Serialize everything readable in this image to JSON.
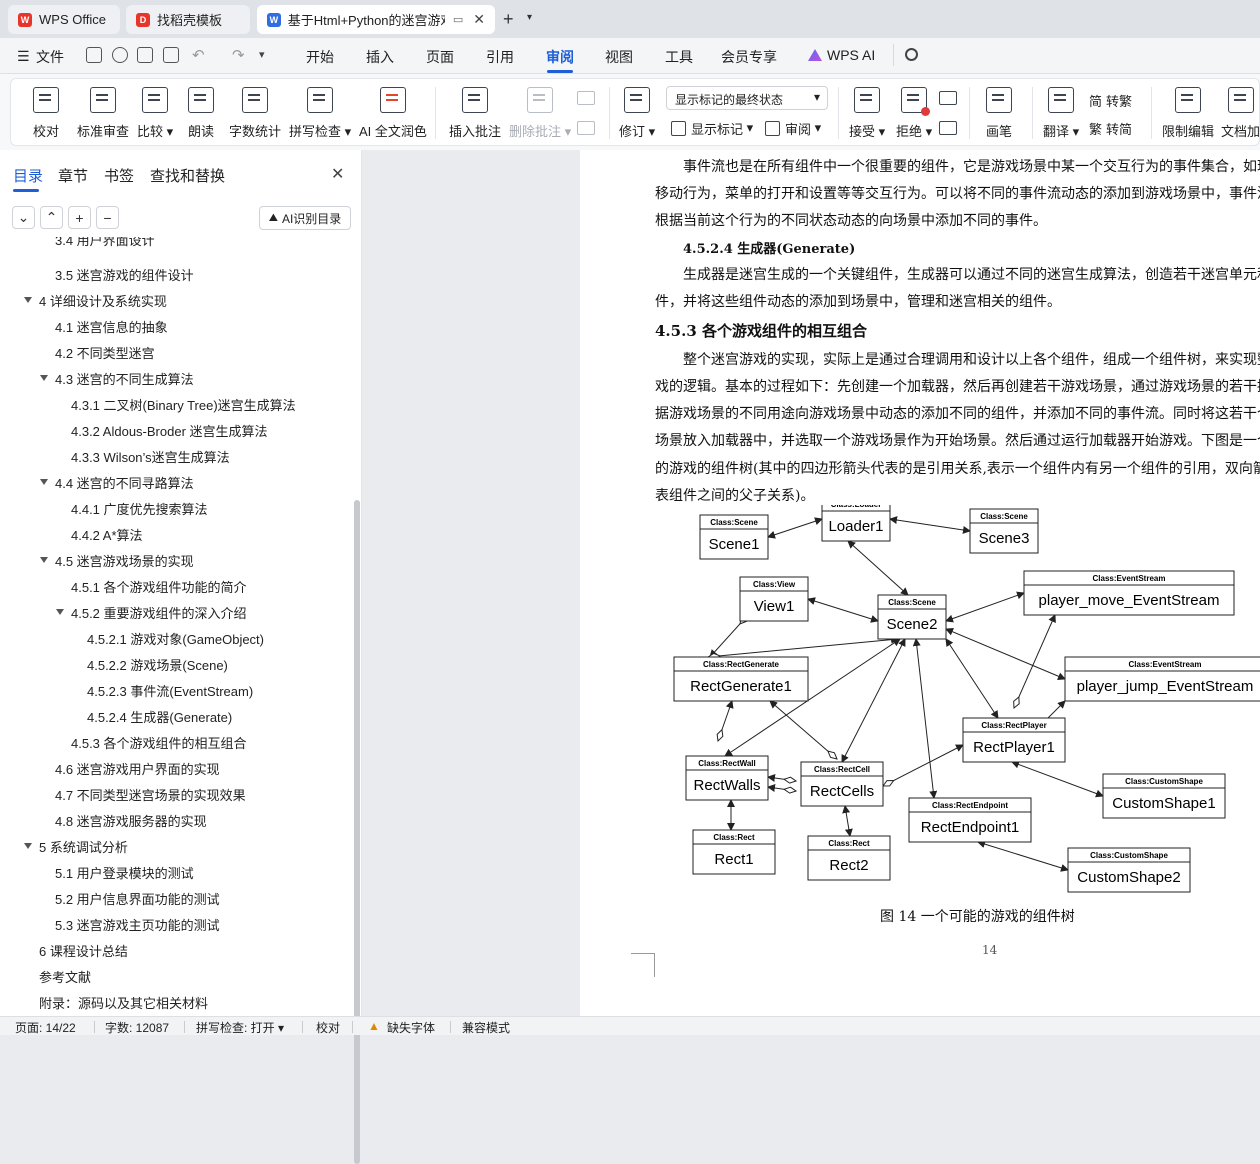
{
  "window": {
    "tabs": [
      {
        "label": "WPS Office",
        "active": false
      },
      {
        "label": "找稻壳模板",
        "active": false
      },
      {
        "label": "基于Html+Python的迷宫游戏",
        "active": true
      }
    ]
  },
  "menubar": {
    "file_label": "文件",
    "items": [
      "开始",
      "插入",
      "页面",
      "引用",
      "审阅",
      "视图",
      "工具",
      "会员专享",
      "WPS AI"
    ],
    "active": "审阅"
  },
  "ribbon": {
    "buttons": [
      {
        "label": "校对"
      },
      {
        "label": "标准审查"
      },
      {
        "label": "比较"
      },
      {
        "label": "朗读"
      },
      {
        "label": "字数统计"
      },
      {
        "label": "拼写检查"
      },
      {
        "label": "AI 全文润色"
      },
      {
        "label": "插入批注"
      },
      {
        "label": "删除批注"
      },
      {
        "label": "修订"
      },
      {
        "label": "显示标记"
      },
      {
        "label": "审阅"
      },
      {
        "label": "接受"
      },
      {
        "label": "拒绝"
      },
      {
        "label": "画笔"
      },
      {
        "label": "翻译"
      },
      {
        "label": "限制编辑"
      },
      {
        "label": "文档加"
      }
    ],
    "markup_select": "显示标记的最终状态",
    "trad_label": "简繁",
    "to_trad": "转繁",
    "to_simp": "转简"
  },
  "panel": {
    "tabs": [
      "目录",
      "章节",
      "书签",
      "查找和替换"
    ],
    "ai_button": "AI识别目录",
    "toc": [
      {
        "text": "3.4  用户界面设计",
        "level": 2
      },
      {
        "text": "3.5  迷宫游戏的组件设计",
        "level": 2
      },
      {
        "text": "4  详细设计及系统实现",
        "level": 1,
        "expanded": true
      },
      {
        "text": "4.1  迷宫信息的抽象",
        "level": 2
      },
      {
        "text": "4.2  不同类型迷宫",
        "level": 2
      },
      {
        "text": "4.3  迷宫的不同生成算法",
        "level": 2,
        "expanded": true
      },
      {
        "text": "4.3.1 二叉树(Binary Tree)迷宫生成算法",
        "level": 3
      },
      {
        "text": "4.3.2 Aldous-Broder 迷宫生成算法",
        "level": 3
      },
      {
        "text": "4.3.3 Wilson’s迷宫生成算法",
        "level": 3
      },
      {
        "text": "4.4  迷宫的不同寻路算法",
        "level": 2,
        "expanded": true
      },
      {
        "text": "4.4.1 广度优先搜索算法",
        "level": 3
      },
      {
        "text": "4.4.2 A*算法",
        "level": 3
      },
      {
        "text": "4.5  迷宫游戏场景的实现",
        "level": 2,
        "expanded": true
      },
      {
        "text": "4.5.1  各个游戏组件功能的简介",
        "level": 3
      },
      {
        "text": "4.5.2  重要游戏组件的深入介绍",
        "level": 3,
        "expanded": true
      },
      {
        "text": "4.5.2.1  游戏对象(GameObject)",
        "level": 4
      },
      {
        "text": "4.5.2.2  游戏场景(Scene)",
        "level": 4
      },
      {
        "text": "4.5.2.3  事件流(EventStream)",
        "level": 4
      },
      {
        "text": "4.5.2.4  生成器(Generate)",
        "level": 4
      },
      {
        "text": "4.5.3  各个游戏组件的相互组合",
        "level": 3
      },
      {
        "text": "4.6  迷宫游戏用户界面的实现",
        "level": 2
      },
      {
        "text": "4.7  不同类型迷宫场景的实现效果",
        "level": 2
      },
      {
        "text": "4.8  迷宫游戏服务器的实现",
        "level": 2
      },
      {
        "text": "5  系统调试分析",
        "level": 1,
        "expanded": true
      },
      {
        "text": "5.1  用户登录模块的测试",
        "level": 2
      },
      {
        "text": "5.2  用户信息界面功能的测试",
        "level": 2
      },
      {
        "text": "5.3  迷宫游戏主页功能的测试",
        "level": 2
      },
      {
        "text": "6  课程设计总结",
        "level": 1
      },
      {
        "text": "参考文献",
        "level": 1
      },
      {
        "text": "附录：源码以及其它相关材料",
        "level": 1
      }
    ]
  },
  "document": {
    "lines": [
      "事件流也是在所有组件中一个很重要的组件，它是游戏场景中某一个交互行为的事件集合，如玩",
      "移动行为，菜单的打开和设置等等交互行为。可以将不同的事件流动态的添加到游戏场景中，事件流",
      "根据当前这个行为的不同状态动态的向场景中添加不同的事件。"
    ],
    "h4": "4.5.2.4  生成器(Generate)",
    "gen_lines": [
      "生成器是迷宫生成的一个关键组件，生成器可以通过不同的迷宫生成算法，创造若干迷宫单元和",
      "件，并将这些组件动态的添加到场景中，管理和迷宫相关的组件。"
    ],
    "h3": "4.5.3  各个游戏组件的相互组合",
    "combo_lines": [
      "整个迷宫游戏的实现，实际上是通过合理调用和设计以上各个组件，组成一个组件树，来实现整个",
      "戏的逻辑。基本的过程如下：先创建一个加载器，然后再创建若干游戏场景，通过游戏场景的若干接",
      "据游戏场景的不同用途向游戏场景中动态的添加不同的组件，并添加不同的事件流。同时将这若干个",
      "场景放入加载器中，并选取一个游戏场景作为开始场景。然后通过运行加载器开始游戏。下图是一个",
      "的游戏的组件树(其中的四边形箭头代表的是引用关系,表示一个组件内有另一个组件的引用，双向箭",
      "表组件之间的父子关系)。"
    ],
    "figure": {
      "caption": "图 14  一个可能的游戏的组件树",
      "nodes": [
        {
          "id": "scene1",
          "cls": "Class:Scene",
          "name": "Scene1"
        },
        {
          "id": "loader1",
          "cls": "Class:Loader",
          "name": "Loader1"
        },
        {
          "id": "scene3",
          "cls": "Class:Scene",
          "name": "Scene3"
        },
        {
          "id": "view1",
          "cls": "Class:View",
          "name": "View1"
        },
        {
          "id": "scene2",
          "cls": "Class:Scene",
          "name": "Scene2"
        },
        {
          "id": "pme",
          "cls": "Class:EventStream",
          "name": "player_move_EventStream"
        },
        {
          "id": "rg1",
          "cls": "Class:RectGenerate",
          "name": "RectGenerate1"
        },
        {
          "id": "pje",
          "cls": "Class:EventStream",
          "name": "player_jump_EventStream"
        },
        {
          "id": "rp1",
          "cls": "Class:RectPlayer",
          "name": "RectPlayer1"
        },
        {
          "id": "rw",
          "cls": "Class:RectWall",
          "name": "RectWalls"
        },
        {
          "id": "rc",
          "cls": "Class:RectCell",
          "name": "RectCells"
        },
        {
          "id": "cs1",
          "cls": "Class:CustomShape",
          "name": "CustomShape1"
        },
        {
          "id": "re1",
          "cls": "Class:RectEndpoint",
          "name": "RectEndpoint1"
        },
        {
          "id": "r1",
          "cls": "Class:Rect",
          "name": "Rect1"
        },
        {
          "id": "r2",
          "cls": "Class:Rect",
          "name": "Rect2"
        },
        {
          "id": "cs2",
          "cls": "Class:CustomShape",
          "name": "CustomShape2"
        }
      ]
    },
    "page_number": "14"
  },
  "status": {
    "page": "页面: 14/22",
    "words": "字数: 12087",
    "spell": "拼写检查: 打开",
    "proof": "校对",
    "missing_font": "缺失字体",
    "compat": "兼容模式"
  }
}
